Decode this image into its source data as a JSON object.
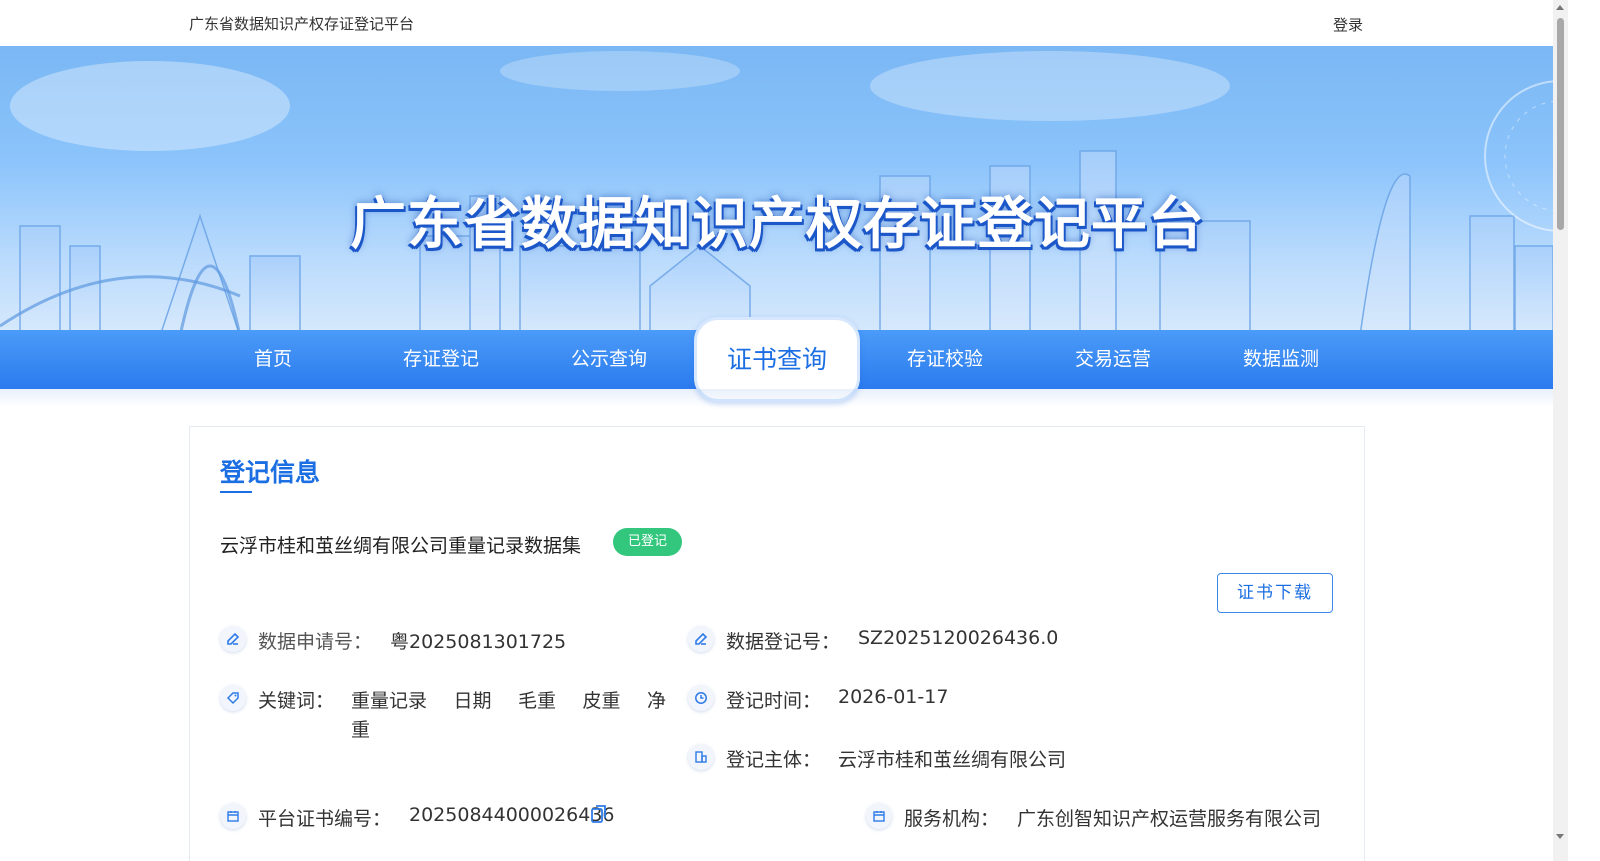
{
  "topbar": {
    "site_name": "广东省数据知识产权存证登记平台",
    "login": "登录"
  },
  "banner": {
    "title": "广东省数据知识产权存证登记平台"
  },
  "nav": {
    "items": [
      "首页",
      "存证登记",
      "公示查询",
      "证书查询",
      "存证校验",
      "交易运营",
      "数据监测"
    ],
    "active": "证书查询"
  },
  "card": {
    "section_title": "登记信息",
    "dataset_name": "云浮市桂和茧丝绸有限公司重量记录数据集",
    "status_badge": "已登记",
    "download_label": "证书下载",
    "fields": {
      "application_no_label": "数据申请号：",
      "application_no": "粤2025081301725",
      "registration_no_label": "数据登记号：",
      "registration_no": "SZ2025120026436.0",
      "keywords_label": "关键词：",
      "keywords": [
        "重量记录",
        "日期",
        "毛重",
        "皮重",
        "净"
      ],
      "keywords_wrap": "重",
      "reg_time_label": "登记时间：",
      "reg_time": "2026-01-17",
      "subject_label": "登记主体：",
      "subject": "云浮市桂和茧丝绸有限公司",
      "cert_no_label": "平台证书编号：",
      "cert_no": "20250844000026436",
      "service_org_label": "服务机构：",
      "service_org": "广东创智知识产权运营服务有限公司"
    }
  },
  "colors": {
    "brand_blue": "#1b6fe3",
    "nav_blue": "#2b7bef",
    "badge_green": "#33c77d"
  }
}
